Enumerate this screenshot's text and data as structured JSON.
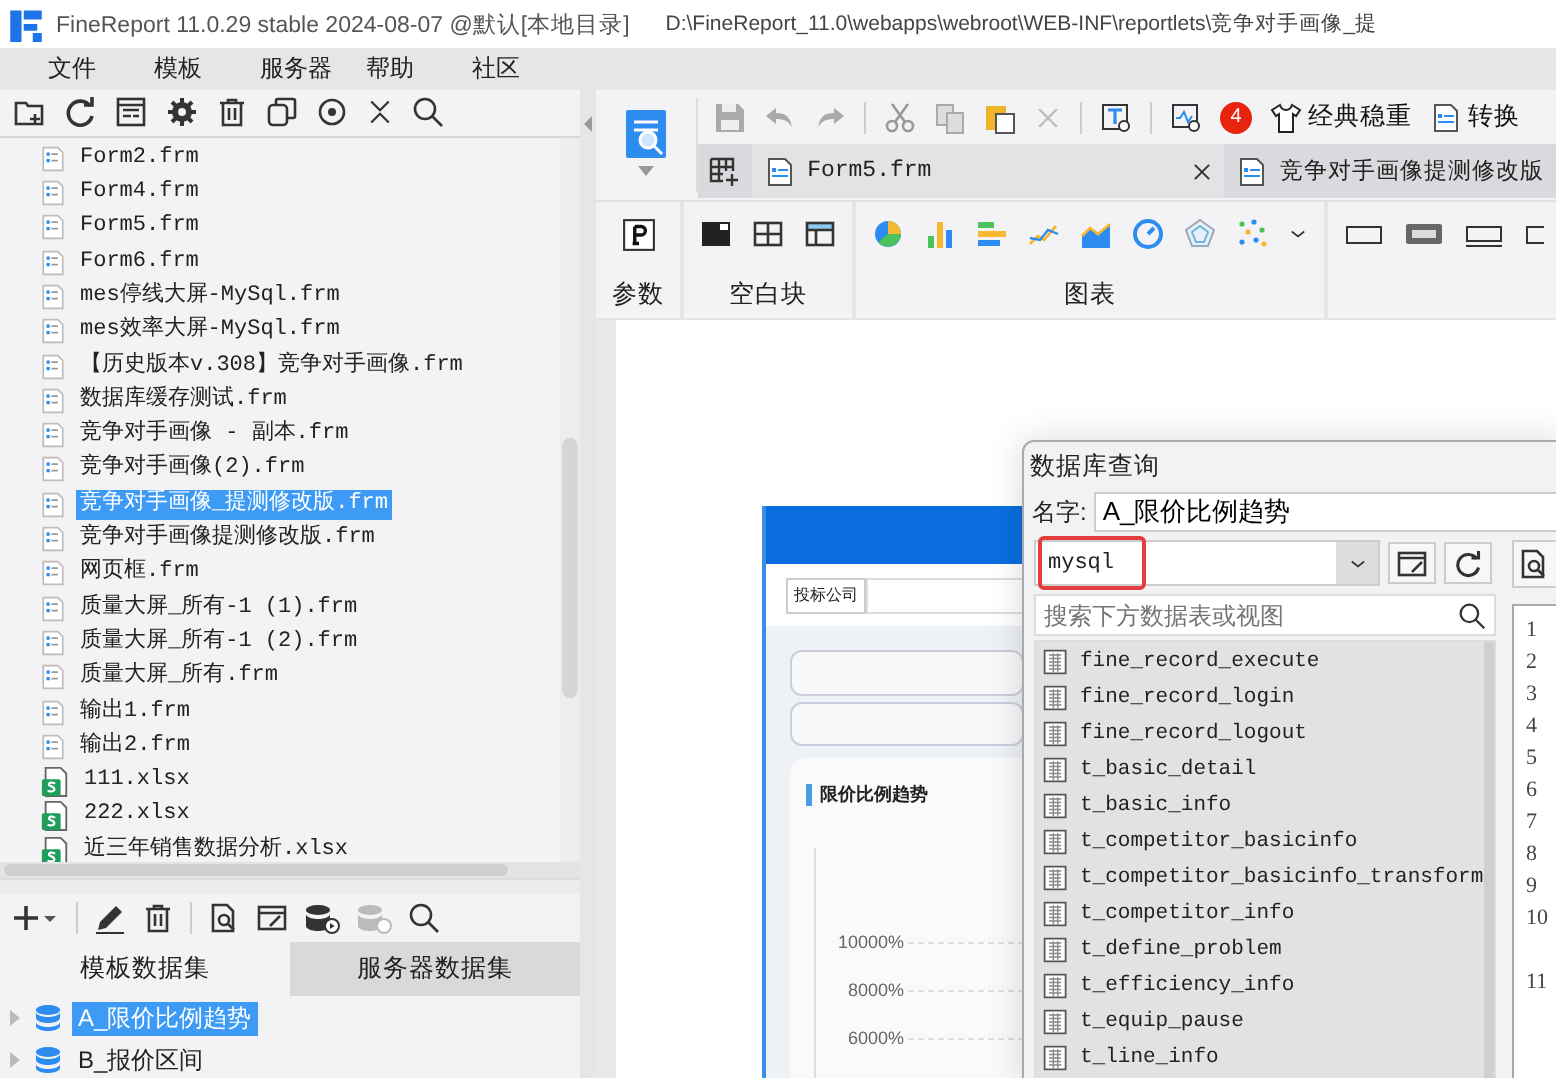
{
  "window": {
    "title": "FineReport 11.0.29 stable 2024-08-07 @默认[本地目录]",
    "path": "D:\\FineReport_11.0\\webapps\\webroot\\WEB-INF\\reportlets\\竞争对手画像_提"
  },
  "menu": [
    "文件",
    "模板",
    "服务器",
    "帮助",
    "社区"
  ],
  "file_tree": [
    {
      "label": "Form2.frm",
      "kind": "form",
      "selected": false
    },
    {
      "label": "Form4.frm",
      "kind": "form",
      "selected": false
    },
    {
      "label": "Form5.frm",
      "kind": "form",
      "selected": false
    },
    {
      "label": "Form6.frm",
      "kind": "form",
      "selected": false
    },
    {
      "label": "mes停线大屏-MySql.frm",
      "kind": "form",
      "selected": false
    },
    {
      "label": "mes效率大屏-MySql.frm",
      "kind": "form",
      "selected": false
    },
    {
      "label": "【历史版本v.308】竞争对手画像.frm",
      "kind": "form",
      "selected": false
    },
    {
      "label": "数据库缓存测试.frm",
      "kind": "form",
      "selected": false
    },
    {
      "label": "竞争对手画像 - 副本.frm",
      "kind": "form",
      "selected": false
    },
    {
      "label": "竞争对手画像(2).frm",
      "kind": "form",
      "selected": false
    },
    {
      "label": "竞争对手画像_提测修改版.frm",
      "kind": "form",
      "selected": true
    },
    {
      "label": "竞争对手画像提测修改版.frm",
      "kind": "form",
      "selected": false
    },
    {
      "label": "网页框.frm",
      "kind": "form",
      "selected": false
    },
    {
      "label": "质量大屏_所有-1 (1).frm",
      "kind": "form",
      "selected": false
    },
    {
      "label": "质量大屏_所有-1 (2).frm",
      "kind": "form",
      "selected": false
    },
    {
      "label": "质量大屏_所有.frm",
      "kind": "form",
      "selected": false
    },
    {
      "label": "输出1.frm",
      "kind": "form",
      "selected": false
    },
    {
      "label": "输出2.frm",
      "kind": "form",
      "selected": false
    },
    {
      "label": "111.xlsx",
      "kind": "sheet",
      "selected": false
    },
    {
      "label": "222.xlsx",
      "kind": "sheet",
      "selected": false
    },
    {
      "label": "近三年销售数据分析.xlsx",
      "kind": "sheet",
      "selected": false
    }
  ],
  "dataset_tabs": [
    {
      "label": "模板数据集",
      "selected": true
    },
    {
      "label": "服务器数据集",
      "selected": false
    }
  ],
  "datasets": [
    {
      "label": "A_限价比例趋势",
      "selected": true
    },
    {
      "label": "B_报价区间",
      "selected": false
    }
  ],
  "toolbar": {
    "notification_count": "4",
    "theme": "经典稳重",
    "convert": "转换"
  },
  "editor_tabs": [
    {
      "label": "Form5.frm",
      "selected": true
    },
    {
      "label": "竞争对手画像提测修改版",
      "selected": false
    }
  ],
  "widget_groups": [
    {
      "label": "参数",
      "kind": "param"
    },
    {
      "label": "空白块",
      "kind": "blocks"
    },
    {
      "label": "图表",
      "kind": "charts"
    }
  ],
  "form_preview": {
    "filter_label": "投标公司",
    "section_title": "限价比例趋势",
    "axis_labels": [
      "10000%",
      "8000%",
      "6000%"
    ]
  },
  "dialog": {
    "title": "数据库查询",
    "name_label": "名字:",
    "name_value": "A_限价比例趋势",
    "connection": "mysql",
    "search_placeholder": "搜索下方数据表或视图",
    "tables": [
      "fine_record_execute",
      "fine_record_login",
      "fine_record_logout",
      "t_basic_detail",
      "t_basic_info",
      "t_competitor_basicinfo",
      "t_competitor_basicinfo_transform",
      "t_competitor_info",
      "t_define_problem",
      "t_efficiency_info",
      "t_equip_pause",
      "t_line_info"
    ],
    "line_numbers": [
      "1",
      "2",
      "3",
      "4",
      "5",
      "6",
      "7",
      "8",
      "9",
      "10",
      "11"
    ]
  }
}
